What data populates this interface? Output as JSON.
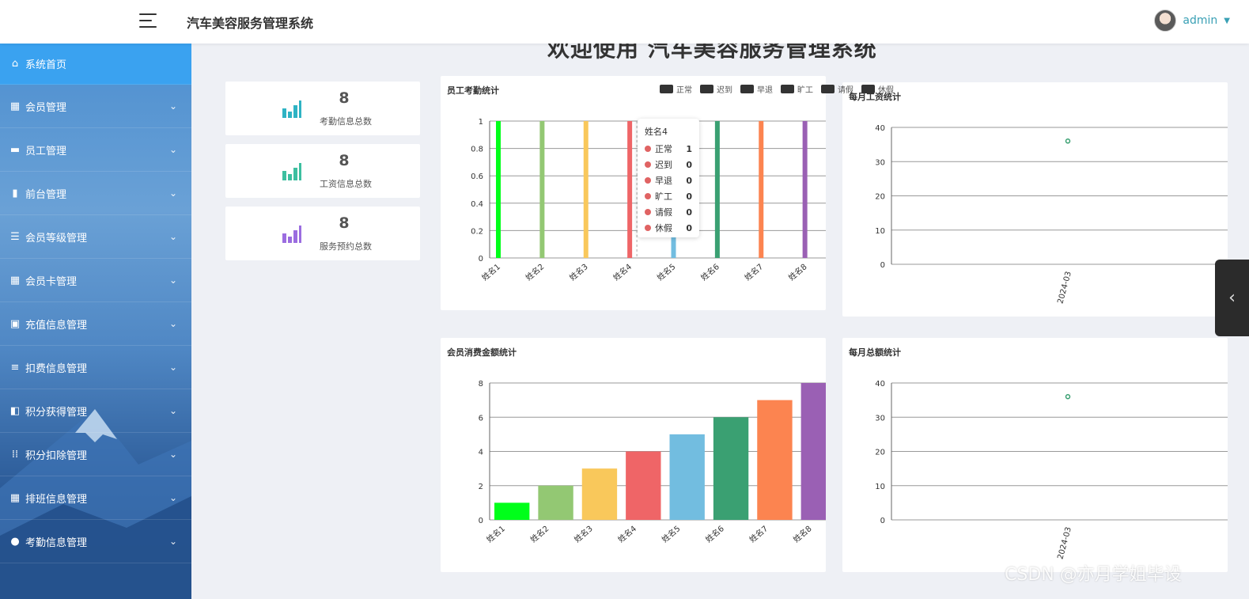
{
  "header": {
    "title": "汽车美容服务管理系统",
    "username": "admin"
  },
  "sidebar": {
    "items": [
      {
        "label": "系统首页",
        "icon": "home-icon"
      },
      {
        "label": "会员管理",
        "icon": "grid-icon"
      },
      {
        "label": "员工管理",
        "icon": "ticket-icon"
      },
      {
        "label": "前台管理",
        "icon": "bar-chart-icon"
      },
      {
        "label": "会员等级管理",
        "icon": "list-icon"
      },
      {
        "label": "会员卡管理",
        "icon": "grid-icon"
      },
      {
        "label": "充值信息管理",
        "icon": "briefcase-icon"
      },
      {
        "label": "扣费信息管理",
        "icon": "sliders-icon"
      },
      {
        "label": "积分获得管理",
        "icon": "wallet-icon"
      },
      {
        "label": "积分扣除管理",
        "icon": "apps-icon"
      },
      {
        "label": "排班信息管理",
        "icon": "grid-icon"
      },
      {
        "label": "考勤信息管理",
        "icon": "user-icon"
      }
    ]
  },
  "welcome": "欢迎使用 汽车美容服务管理系统",
  "stats": [
    {
      "value": "8",
      "label": "考勤信息总数",
      "color": "#2fb3c4"
    },
    {
      "value": "8",
      "label": "工资信息总数",
      "color": "#3dbfa0"
    },
    {
      "value": "8",
      "label": "服务预约总数",
      "color": "#9b6de0"
    }
  ],
  "panels": {
    "attendance": "员工考勤统计",
    "salary": "每月工资统计",
    "consumption": "会员消费金额统计",
    "total": "每月总额统计"
  },
  "tooltip": {
    "title": "姓名4",
    "rows": [
      {
        "name": "正常",
        "value": "1"
      },
      {
        "name": "迟到",
        "value": "0"
      },
      {
        "name": "早退",
        "value": "0"
      },
      {
        "name": "旷工",
        "value": "0"
      },
      {
        "name": "请假",
        "value": "0"
      },
      {
        "name": "休假",
        "value": "0"
      }
    ]
  },
  "watermark": "CSDN @亦月学姐毕设",
  "chart_data": [
    {
      "type": "bar",
      "title": "员工考勤统计",
      "categories": [
        "姓名1",
        "姓名2",
        "姓名3",
        "姓名4",
        "姓名5",
        "姓名6",
        "姓名7",
        "姓名8"
      ],
      "legend": [
        "正常",
        "迟到",
        "早退",
        "旷工",
        "请假",
        "休假"
      ],
      "series": [
        {
          "name": "正常",
          "values": [
            1,
            1,
            1,
            1,
            1,
            1,
            1,
            1
          ]
        },
        {
          "name": "迟到",
          "values": [
            0,
            0,
            0,
            0,
            0,
            0,
            0,
            0
          ]
        },
        {
          "name": "早退",
          "values": [
            0,
            0,
            0,
            0,
            0,
            0,
            0,
            0
          ]
        },
        {
          "name": "旷工",
          "values": [
            0,
            0,
            0,
            0,
            0,
            0,
            0,
            0
          ]
        },
        {
          "name": "请假",
          "values": [
            0,
            0,
            0,
            0,
            0,
            0,
            0,
            0
          ]
        },
        {
          "name": "休假",
          "values": [
            0,
            0,
            0,
            0,
            0,
            0,
            0,
            0
          ]
        }
      ],
      "colors": [
        "#00ff1a",
        "#93c873",
        "#f9c85b",
        "#ef6567",
        "#72bde0",
        "#3aa072",
        "#fc8450",
        "#9a60b4"
      ],
      "ylim": [
        0,
        1
      ],
      "yticks": [
        "0",
        "0.2",
        "0.4",
        "0.6",
        "0.8",
        "1"
      ],
      "legend_position": "top-right",
      "grid": true
    },
    {
      "type": "scatter",
      "title": "每月工资统计",
      "x": [
        "2024-03"
      ],
      "y": [
        36
      ],
      "ylim": [
        0,
        40
      ],
      "yticks": [
        "0",
        "10",
        "20",
        "30",
        "40"
      ],
      "grid": true
    },
    {
      "type": "bar",
      "title": "会员消费金额统计",
      "categories": [
        "姓名1",
        "姓名2",
        "姓名3",
        "姓名4",
        "姓名5",
        "姓名6",
        "姓名7",
        "姓名8"
      ],
      "values": [
        1,
        2,
        3,
        4,
        5,
        6,
        7,
        8
      ],
      "colors": [
        "#00ff1a",
        "#93c873",
        "#f9c85b",
        "#ef6567",
        "#72bde0",
        "#3aa072",
        "#fc8450",
        "#9a60b4"
      ],
      "ylim": [
        0,
        8
      ],
      "yticks": [
        "0",
        "2",
        "4",
        "6",
        "8"
      ],
      "grid": true
    },
    {
      "type": "scatter",
      "title": "每月总额统计",
      "x": [
        "2024-03"
      ],
      "y": [
        36
      ],
      "ylim": [
        0,
        40
      ],
      "yticks": [
        "0",
        "10",
        "20",
        "30",
        "40"
      ],
      "grid": true
    }
  ]
}
